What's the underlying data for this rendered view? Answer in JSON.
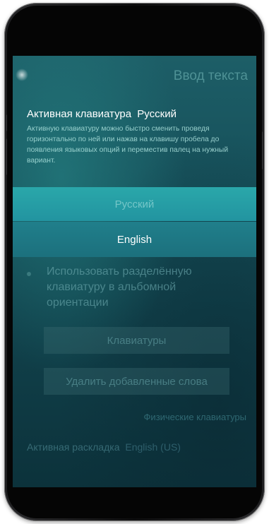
{
  "header": {
    "title": "Ввод текста"
  },
  "active_keyboard": {
    "label": "Активная клавиатура",
    "value": "Русский",
    "description": "Активную клавиатуру можно быстро сменить проведя горизонтально по ней или нажав на клавишу пробела до появления языковых опций и переместив палец на нужный вариант."
  },
  "language_options": [
    {
      "label": "Русский",
      "selected": false
    },
    {
      "label": "English",
      "selected": true
    }
  ],
  "split_keyboard": {
    "label": "Использовать разделённую клавиатуру в альбомной ориентации",
    "enabled": false
  },
  "buttons": {
    "keyboards": "Клавиатуры",
    "delete_words": "Удалить добавленные слова"
  },
  "physical_keyboards_link": "Физические клавиатуры",
  "active_layout": {
    "label": "Активная раскладка",
    "value": "English (US)"
  },
  "colors": {
    "accent": "#2aa7aa",
    "selected_row": "#207f8b",
    "background": "#16505a"
  }
}
